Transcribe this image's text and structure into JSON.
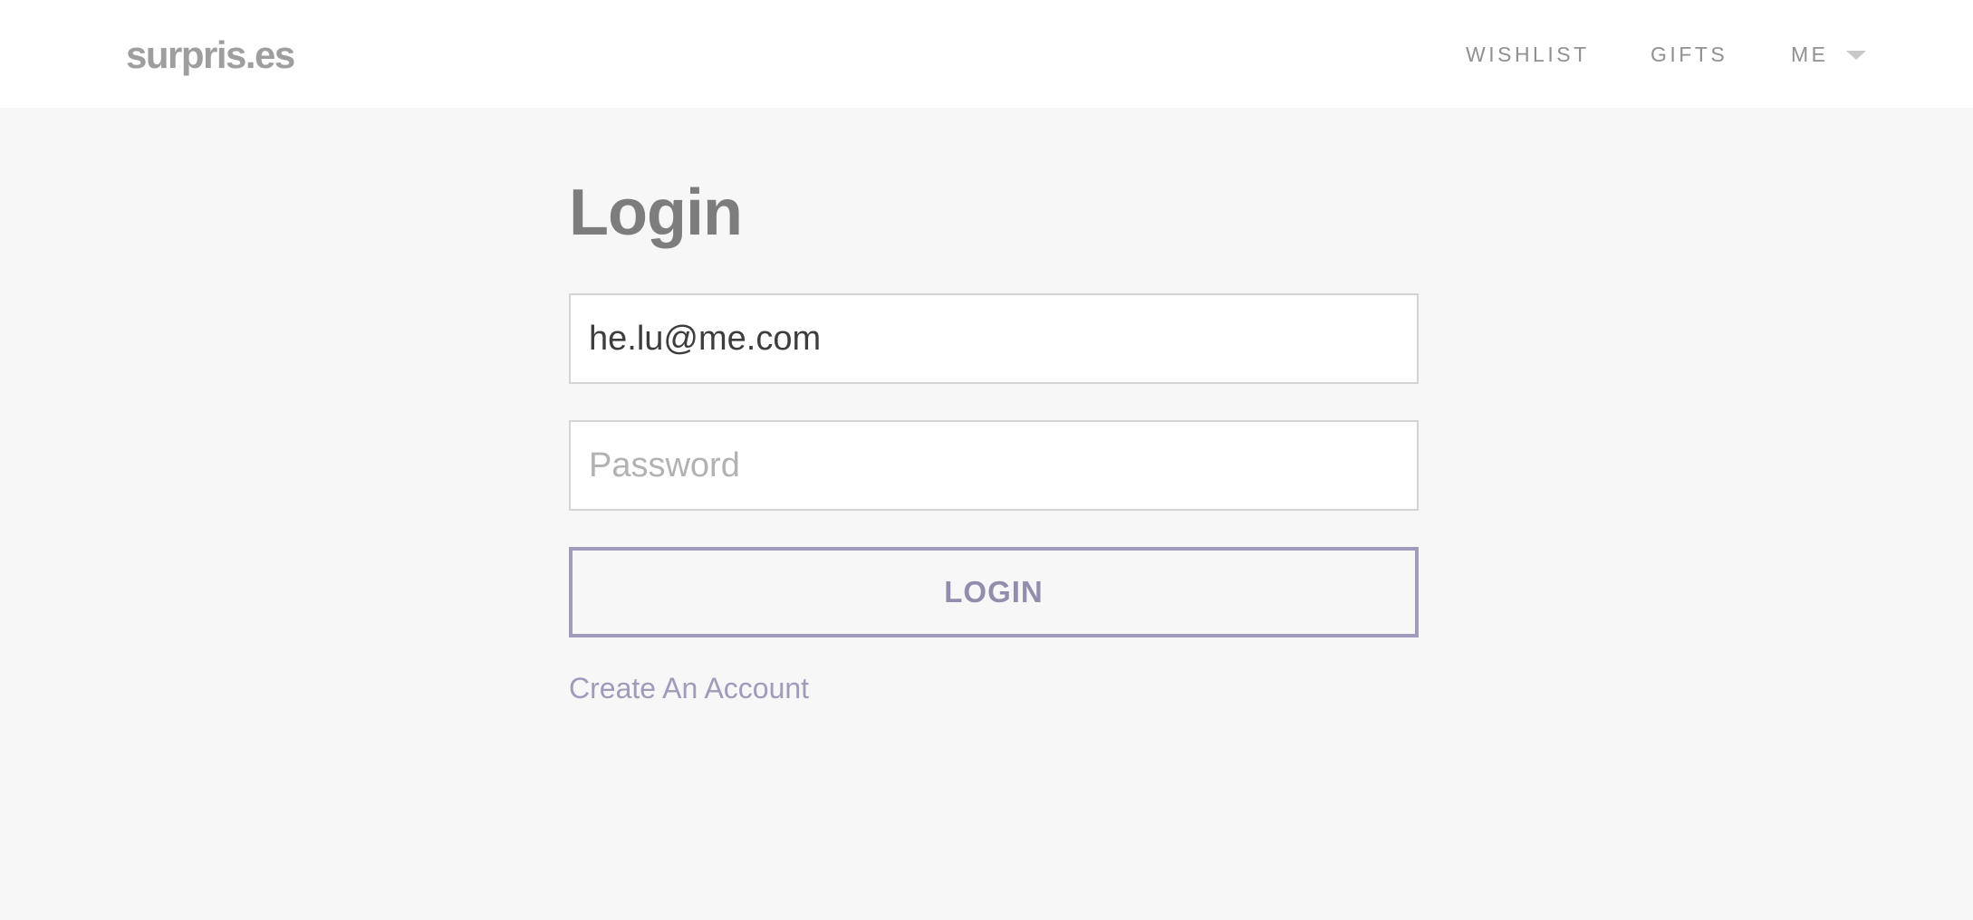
{
  "header": {
    "logo": "surpris.es",
    "nav": {
      "wishlist": "WISHLIST",
      "gifts": "GIFTS",
      "me": "ME"
    },
    "me_menu_icon": "chevron-down-icon"
  },
  "login": {
    "title": "Login",
    "email_value": "he.lu@me.com",
    "password_placeholder": "Password",
    "submit_label": "LOGIN",
    "create_account_label": "Create An Account"
  },
  "colors": {
    "page_background": "#f7f7f7",
    "header_background": "#ffffff",
    "accent": "#a09bba",
    "logo": "#9e9e9e",
    "title": "#7d7d7d"
  }
}
